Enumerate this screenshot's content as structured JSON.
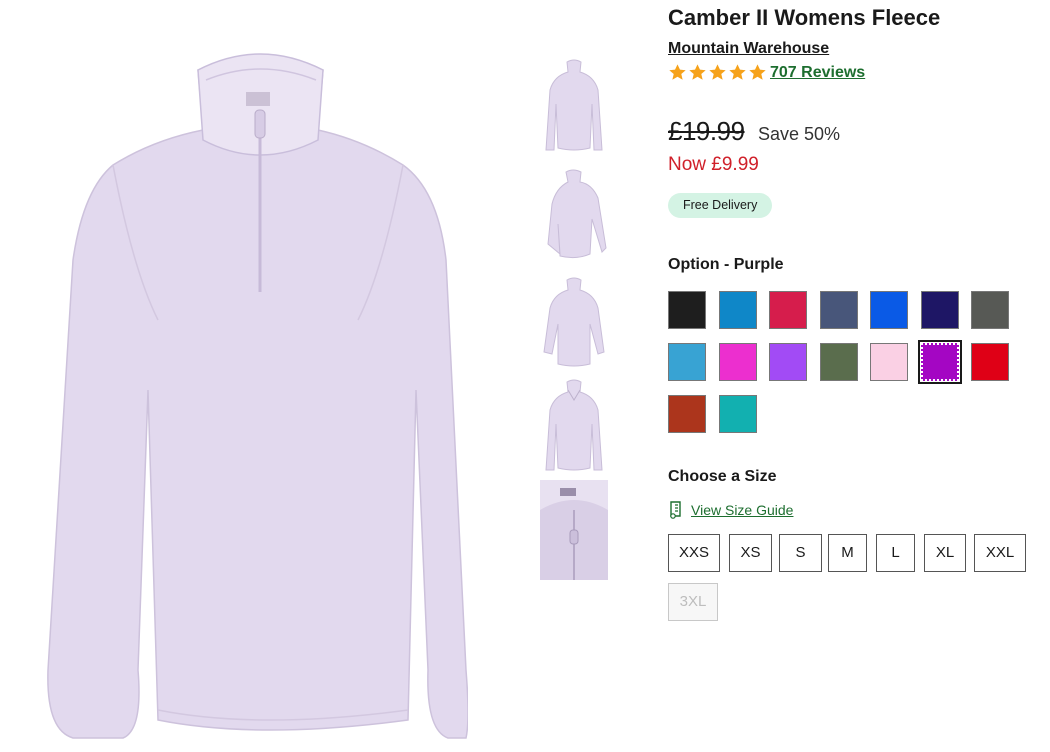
{
  "product": {
    "title": "Camber II Womens Fleece",
    "brand": "Mountain Warehouse",
    "rating_stars": 5,
    "reviews_label": "707 Reviews",
    "was_price": "£19.99",
    "save_text": "Save 50%",
    "now_price": "Now £9.99",
    "delivery_badge": "Free Delivery"
  },
  "colours": {
    "label": "Option - Purple",
    "selected": "Purple",
    "swatches": [
      {
        "name": "Black",
        "hex": "#1e1e1e"
      },
      {
        "name": "Blue",
        "hex": "#0f87c8"
      },
      {
        "name": "Pink",
        "hex": "#d61d4c"
      },
      {
        "name": "Navy",
        "hex": "#48567a"
      },
      {
        "name": "Bright Blue",
        "hex": "#0a5ae6"
      },
      {
        "name": "Indigo",
        "hex": "#1e1665"
      },
      {
        "name": "Grey",
        "hex": "#575955"
      },
      {
        "name": "Light Blue",
        "hex": "#38a3d3"
      },
      {
        "name": "Magenta",
        "hex": "#ec2fcf"
      },
      {
        "name": "Violet",
        "hex": "#a24bf5"
      },
      {
        "name": "Green",
        "hex": "#5a6d4d"
      },
      {
        "name": "Pale Pink",
        "hex": "#fad0e4"
      },
      {
        "name": "Purple",
        "hex": "#a406c3"
      },
      {
        "name": "Red",
        "hex": "#df0016"
      },
      {
        "name": "Rust",
        "hex": "#ac351c"
      },
      {
        "name": "Teal",
        "hex": "#12b0b0"
      }
    ]
  },
  "size": {
    "label": "Choose a Size",
    "guide_link": "View Size Guide",
    "options": [
      {
        "label": "XXS",
        "available": true
      },
      {
        "label": "XS",
        "available": true
      },
      {
        "label": "S",
        "available": true
      },
      {
        "label": "M",
        "available": true
      },
      {
        "label": "L",
        "available": true
      },
      {
        "label": "XL",
        "available": true
      },
      {
        "label": "XXL",
        "available": true
      },
      {
        "label": "3XL",
        "available": false
      }
    ]
  },
  "theme": {
    "garment_color": "#e1d8ec",
    "link_green": "#1d6e2f",
    "sale_red": "#d0202a",
    "star_color": "#f6a21a"
  },
  "icons": [
    "star-icon",
    "size-guide-icon"
  ]
}
